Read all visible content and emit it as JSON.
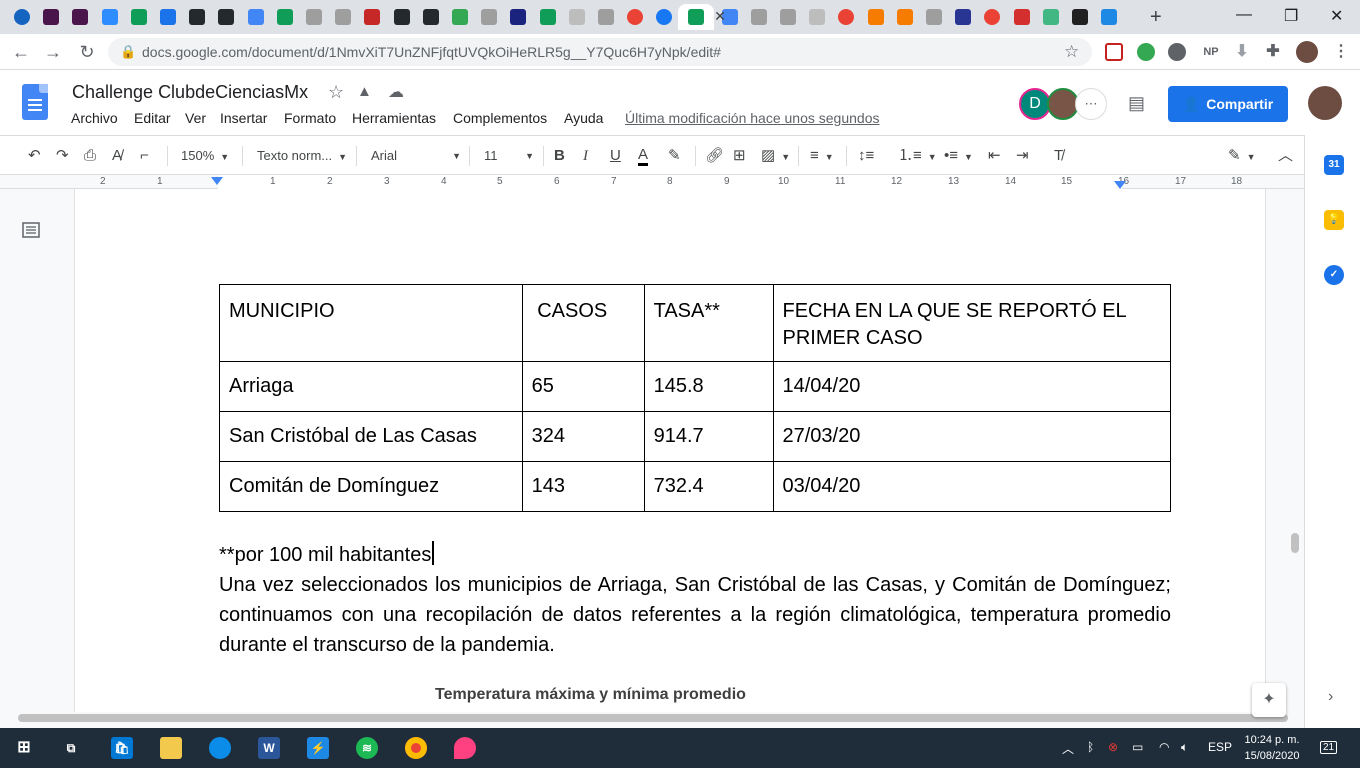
{
  "browser": {
    "url": "docs.google.com/document/d/1NmvXiT7UnZNFjfqtUVQkOiHeRLR5g__Y7Quc6H7yNpk/edit#",
    "tab_icons": [
      "youtube-icon",
      "slack-icon",
      "slack-icon",
      "video-icon",
      "drive-icon",
      "meet-icon",
      "github-icon",
      "github-icon",
      "docs-icon",
      "sheets-icon",
      "generic-icon",
      "generic-icon",
      "badge-icon",
      "github-icon",
      "github-icon",
      "maps-icon",
      "generic-icon",
      "letter-l-icon",
      "drive-icon",
      "news-icon",
      "generic-icon",
      "google-icon",
      "facebook-icon",
      "classroom-icon",
      "docs-icon",
      "generic-icon",
      "generic-icon",
      "news-icon",
      "google-icon",
      "books-icon",
      "books-icon",
      "generic-icon",
      "hcc-icon",
      "google-icon",
      "opera-icon",
      "vue-icon",
      "st-icon",
      "reddit-icon"
    ],
    "extension_labels": {
      "np": "NP"
    }
  },
  "doc": {
    "title": "Challenge ClubdeCienciasMx",
    "menus": [
      "Archivo",
      "Editar",
      "Ver",
      "Insertar",
      "Formato",
      "Herramientas",
      "Complementos",
      "Ayuda"
    ],
    "last_modified": "Última modificación hace unos segundos",
    "avatar_initial": "D",
    "share_label": "Compartir"
  },
  "toolbar": {
    "zoom": "150%",
    "style": "Texto norm...",
    "font": "Arial",
    "size": "11"
  },
  "ruler": {
    "numbers": [
      "2",
      "1",
      "1",
      "2",
      "3",
      "4",
      "5",
      "6",
      "7",
      "8",
      "9",
      "10",
      "11",
      "12",
      "13",
      "14",
      "15",
      "16",
      "17",
      "18"
    ]
  },
  "table": {
    "headers": [
      "MUNICIPIO",
      " CASOS",
      "TASA**",
      "FECHA EN LA QUE SE REPORTÓ EL PRIMER CASO"
    ],
    "rows": [
      [
        "Arriaga",
        "65",
        "145.8",
        "14/04/20"
      ],
      [
        "San Cristóbal de Las Casas",
        "324",
        "914.7",
        "27/03/20"
      ],
      [
        "Comitán de Domínguez",
        "143",
        "732.4",
        "03/04/20"
      ]
    ]
  },
  "body": {
    "note": "**por 100 mil habitantes",
    "paragraph": "Una vez seleccionados los municipios de Arriaga, San Cristóbal de las Casas, y Comitán de Domínguez; continuamos con una recopilación de datos referentes a la región climatológica, temperatura promedio durante el transcurso de la pandemia.",
    "chart_title": "Temperatura máxima y mínima promedio"
  },
  "taskbar": {
    "language": "ESP",
    "time": "10:24 p. m.",
    "date": "15/08/2020",
    "notifications": "21"
  }
}
